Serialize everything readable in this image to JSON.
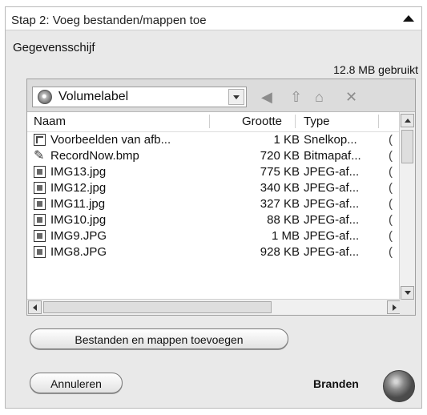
{
  "header": {
    "title": "Stap 2: Voeg bestanden/mappen toe"
  },
  "section": {
    "label": "Gegevensschijf",
    "usage": "12.8 MB gebruikt"
  },
  "browser": {
    "volume_label": "Volumelabel",
    "icons": [
      "back-icon",
      "up-folder-icon",
      "new-folder-icon",
      "delete-icon"
    ],
    "columns": {
      "name": "Naam",
      "size": "Grootte",
      "type": "Type"
    },
    "rows": [
      {
        "icon": "shortcut-file-icon",
        "name": "Voorbeelden van afb...",
        "size": "1 KB",
        "type": "Snelkop...",
        "extra": "("
      },
      {
        "icon": "bitmap-file-icon",
        "name": "RecordNow.bmp",
        "size": "720 KB",
        "type": "Bitmapaf...",
        "extra": "("
      },
      {
        "icon": "image-file-icon",
        "name": "IMG13.jpg",
        "size": "775 KB",
        "type": "JPEG-af...",
        "extra": "("
      },
      {
        "icon": "image-file-icon",
        "name": "IMG12.jpg",
        "size": "340 KB",
        "type": "JPEG-af...",
        "extra": "("
      },
      {
        "icon": "image-file-icon",
        "name": "IMG11.jpg",
        "size": "327 KB",
        "type": "JPEG-af...",
        "extra": "("
      },
      {
        "icon": "image-file-icon",
        "name": "IMG10.jpg",
        "size": "88 KB",
        "type": "JPEG-af...",
        "extra": "("
      },
      {
        "icon": "image-file-icon",
        "name": "IMG9.JPG",
        "size": "1 MB",
        "type": "JPEG-af...",
        "extra": "("
      },
      {
        "icon": "image-file-icon",
        "name": "IMG8.JPG",
        "size": "928 KB",
        "type": "JPEG-af...",
        "extra": "("
      }
    ]
  },
  "buttons": {
    "add": "Bestanden en mappen toevoegen",
    "cancel": "Annuleren",
    "burn": "Branden"
  },
  "colors": {
    "panel": "#e9e9e9",
    "burn_button": "#6e6e6e"
  }
}
